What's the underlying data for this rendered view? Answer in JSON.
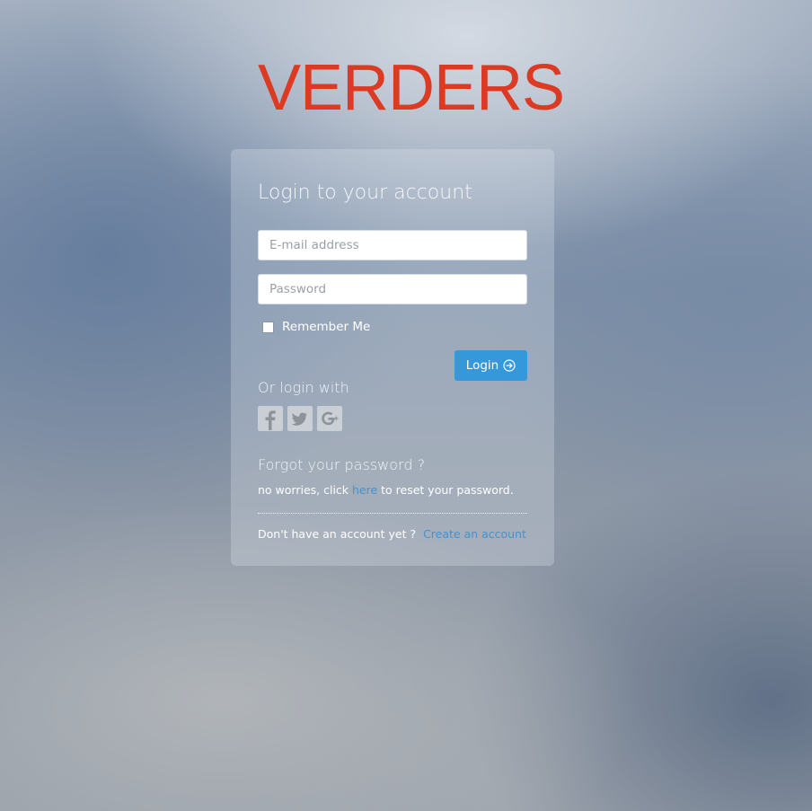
{
  "brand": {
    "logo_text": "VERDERS",
    "logo_color": "#dd3a24"
  },
  "login_form": {
    "title": "Login to your account",
    "email_placeholder": "E-mail address",
    "email_value": "",
    "password_placeholder": "Password",
    "password_value": "",
    "remember_label": "Remember Me",
    "remember_checked": false,
    "login_button_label": "Login",
    "login_button_icon": "arrow-circle-right-icon",
    "accent_color": "#3498db"
  },
  "social_login": {
    "heading": "Or login with",
    "providers": [
      {
        "name": "facebook",
        "icon": "facebook-icon"
      },
      {
        "name": "twitter",
        "icon": "twitter-icon"
      },
      {
        "name": "google-plus",
        "icon": "google-plus-icon"
      }
    ]
  },
  "forgot_password": {
    "heading": "Forgot your password ?",
    "text_before": "no worries, click ",
    "link_text": "here",
    "text_after": " to reset your password."
  },
  "signup": {
    "prompt": "Don't have an account yet ?",
    "link_text": "Create an account"
  }
}
